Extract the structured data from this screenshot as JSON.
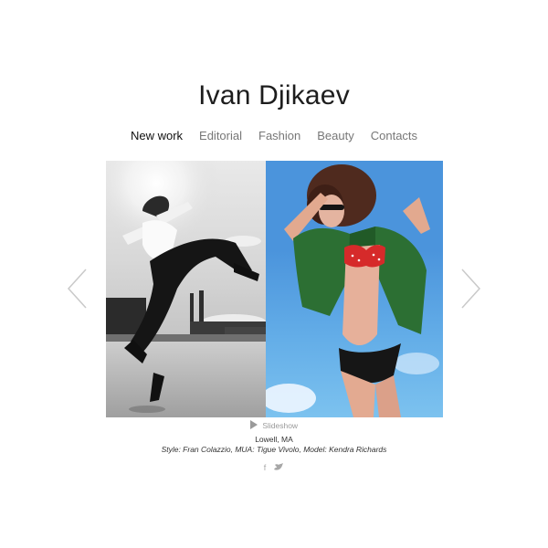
{
  "header": {
    "title": "Ivan Djikaev"
  },
  "nav": {
    "items": [
      {
        "label": "New work"
      },
      {
        "label": "Editorial"
      },
      {
        "label": "Fashion"
      },
      {
        "label": "Beauty"
      },
      {
        "label": "Contacts"
      }
    ]
  },
  "slider": {
    "prev_icon": "chevron-left-icon",
    "next_icon": "chevron-right-icon",
    "slideshow_label": "Slideshow",
    "caption_location": "Lowell, MA",
    "caption_credits": "Style: Fran Colazzio, MUA: Tigue Vivolo, Model: Kendra Richards"
  },
  "social": {
    "facebook_label": "f",
    "twitter_label": "twitter"
  },
  "colors": {
    "accent_sky": "#4b94dc",
    "accent_green": "#2c6f33",
    "accent_red": "#d62a2a"
  }
}
